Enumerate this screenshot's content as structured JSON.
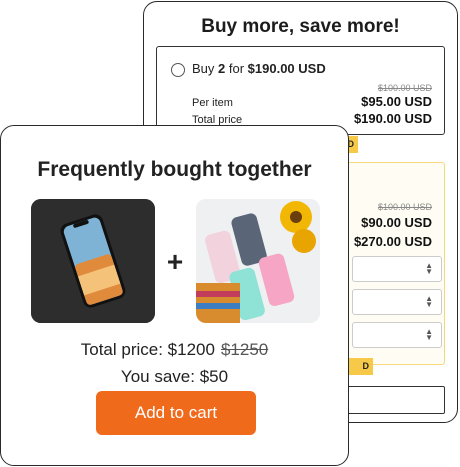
{
  "upsell": {
    "title": "Buy more, save more!",
    "offer1": {
      "prefix": "Buy ",
      "qty": "2",
      "for_word": " for ",
      "price": "$190.00 USD",
      "compare_price": "$100.00 USD",
      "per_item_label": "Per item",
      "per_item_price": "$95.00 USD",
      "total_label": "Total price",
      "total_price": "$190.00 USD",
      "badge": "D"
    },
    "offer2": {
      "compare_price": "$100.00 USD",
      "per_item_price": "$90.00 USD",
      "total_price": "$270.00 USD",
      "badge": "D"
    }
  },
  "bundle": {
    "title": "Frequently bought together",
    "product1": "phone-image",
    "product2": "phone-cases-image",
    "total_label": "Total price: $1200",
    "old_total": "$1250",
    "save_text": "You save: $50",
    "cta_label": "Add to cart"
  },
  "colors": {
    "accent": "#f06a1c",
    "badge": "#f7c948"
  }
}
